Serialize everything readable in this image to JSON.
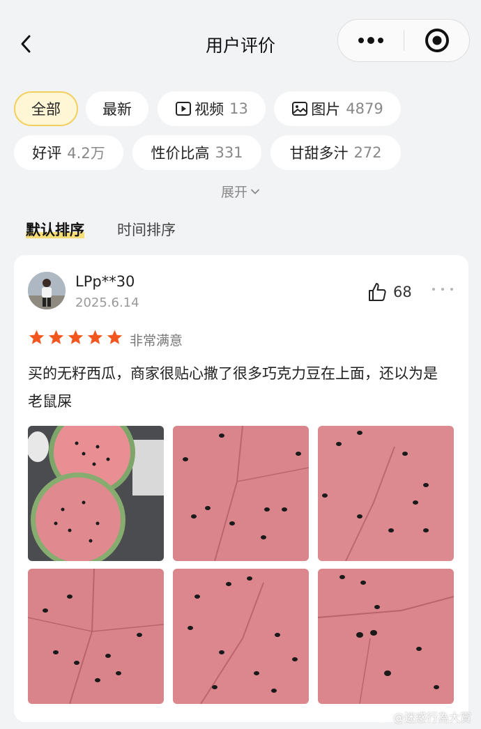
{
  "header": {
    "title": "用户评价"
  },
  "filters": {
    "all": "全部",
    "latest": "最新",
    "video_label": "视频",
    "video_count": "13",
    "image_label": "图片",
    "image_count": "4879",
    "good_label": "好评",
    "good_count": "4.2万",
    "value_label": "性价比高",
    "value_count": "331",
    "sweet_label": "甘甜多汁",
    "sweet_count": "272"
  },
  "expand_label": "展开",
  "sort": {
    "default": "默认排序",
    "time": "时间排序"
  },
  "review": {
    "username": "LPp**30",
    "date": "2025.6.14",
    "likes": "68",
    "stars": 5,
    "rating_text": "非常满意",
    "text": "买的无籽西瓜，商家很贴心撒了很多巧克力豆在上面，还以为是老鼠屎"
  },
  "watermark": "@迷惑行為大賞",
  "colors": {
    "star": "#f4561f",
    "accent_highlight": "#f7d64b",
    "chip_active_bg": "#fff6d6"
  }
}
